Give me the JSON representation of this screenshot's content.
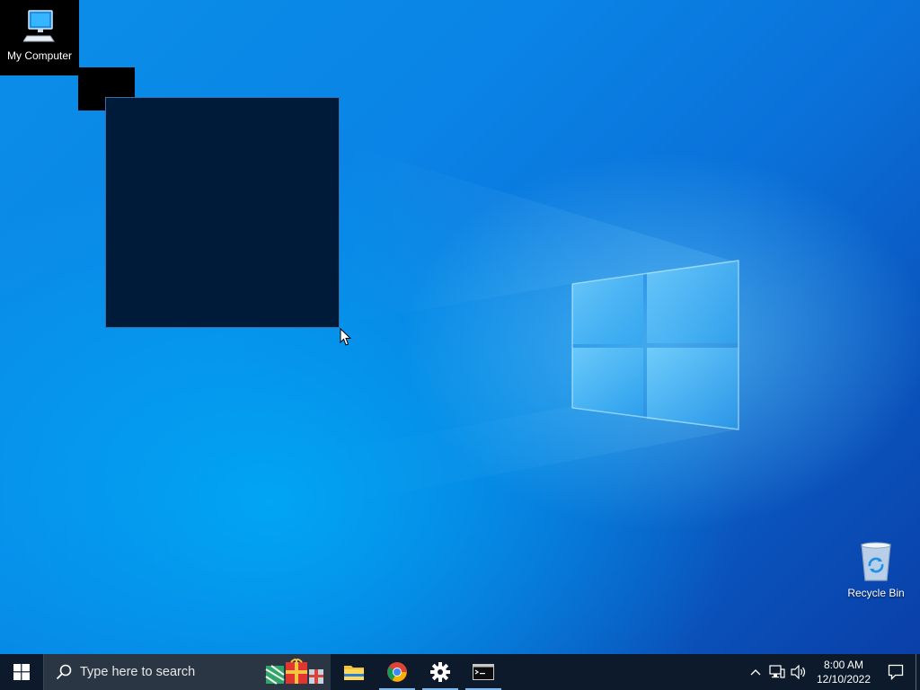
{
  "desktop": {
    "icons": [
      {
        "label": "My Computer",
        "icon": "computer-icon"
      },
      {
        "label": "Recycle Bin",
        "icon": "recycle-bin-icon"
      }
    ]
  },
  "taskbar": {
    "search_placeholder": "Type here to search",
    "pinned": [
      {
        "name": "File Explorer",
        "icon": "folder-icon"
      },
      {
        "name": "Google Chrome",
        "icon": "chrome-icon"
      },
      {
        "name": "Settings",
        "icon": "gear-icon"
      },
      {
        "name": "Command Prompt",
        "icon": "terminal-icon"
      }
    ]
  },
  "tray": {
    "time": "8:00 AM",
    "date": "12/10/2022"
  },
  "colors": {
    "taskbar": "#0c1a2b",
    "search_box": "#2b3645",
    "selection_fill": "#001a3a",
    "wallpaper_accent": "#0a84e6"
  }
}
